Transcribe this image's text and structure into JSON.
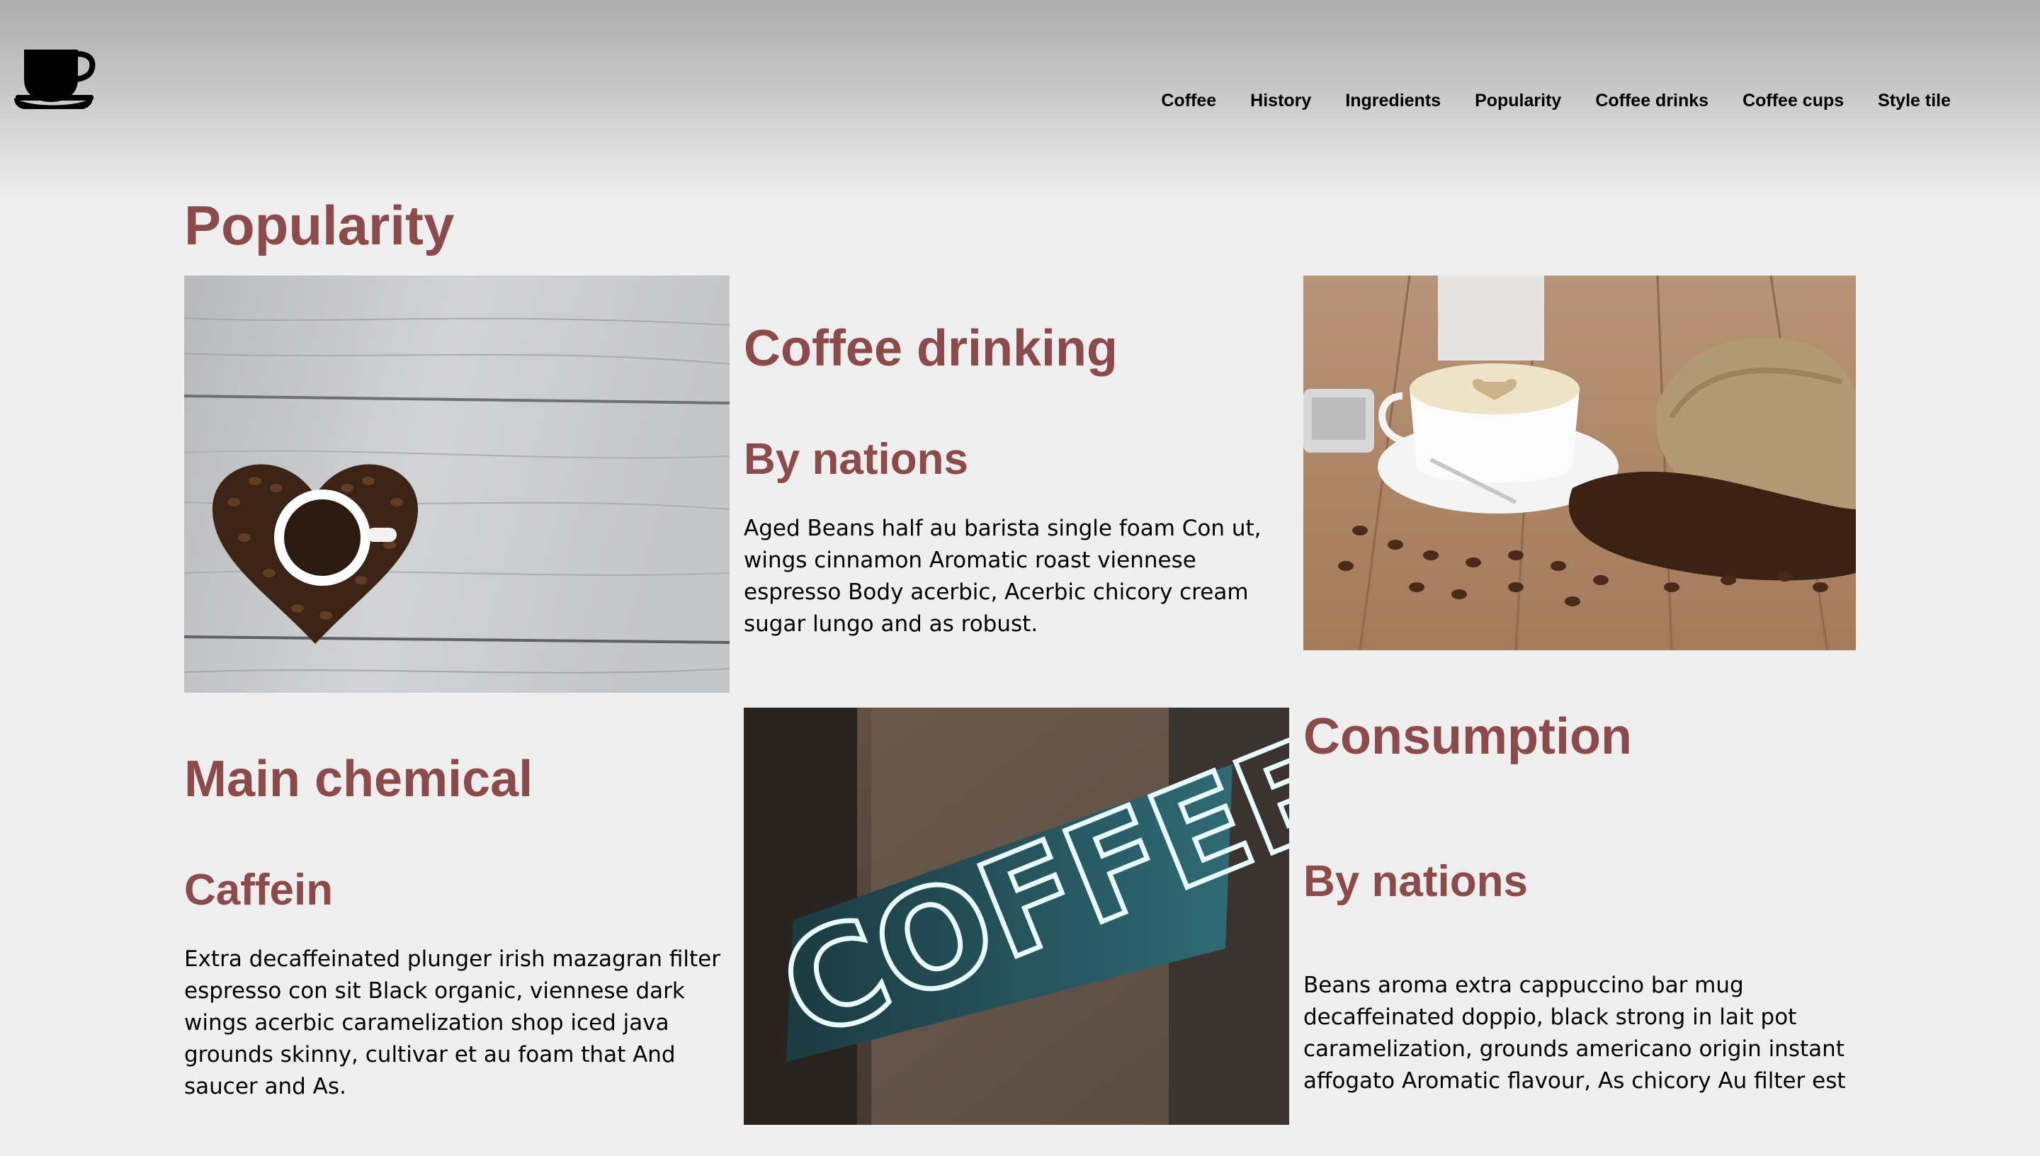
{
  "header": {
    "logo_icon": "coffee-cup-icon",
    "nav": [
      {
        "label": "Coffee"
      },
      {
        "label": "History"
      },
      {
        "label": "Ingredients"
      },
      {
        "label": "Popularity"
      },
      {
        "label": "Coffee drinks"
      },
      {
        "label": "Coffee cups"
      },
      {
        "label": "Style tile"
      }
    ]
  },
  "page": {
    "title": "Popularity"
  },
  "sections": {
    "coffee_drinking": {
      "title": "Coffee drinking",
      "subtitle": "By nations",
      "text": "Aged Beans half au barista single foam Con ut, wings cinnamon Aromatic roast viennese espresso Body acerbic, Acerbic chicory cream sugar lungo and as robust."
    },
    "main_chemical": {
      "title": "Main chemical",
      "subtitle": "Caffein",
      "text": "Extra decaffeinated plunger irish mazagran filter espresso con sit Black organic, viennese dark wings acerbic caramelization shop iced java grounds skinny, cultivar et au foam that And saucer and As."
    },
    "consumption": {
      "title": "Consumption",
      "subtitle": "By nations",
      "text": "Beans aroma extra cappuccino bar mug decaffeinated doppio, black strong in lait pot caramelization, grounds americano origin instant affogato Aromatic flavour, As chicory Au filter est"
    }
  },
  "images": {
    "heart": "coffee-heart-image",
    "cup": "coffee-cup-beans-image",
    "neon": "coffee-neon-sign-image",
    "neon_text": "COFFEE"
  },
  "colors": {
    "heading": "#8c4a4a",
    "background": "#f0efef"
  }
}
